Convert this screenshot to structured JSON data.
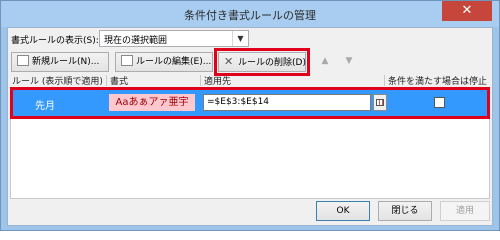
{
  "window": {
    "title": "条件付き書式ルールの管理",
    "close_symbol": "✕"
  },
  "show_rules": {
    "label": "書式ルールの表示(S):",
    "value": "現在の選択範囲"
  },
  "toolbar": {
    "new_rule": "新規ルール(N)...",
    "edit_rule": "ルールの編集(E)...",
    "delete_rule": "ルールの削除(D)",
    "move_up": "▲",
    "move_down": "▼"
  },
  "columns": {
    "rule": "ルール (表示順で適用)",
    "format": "書式",
    "applies_to": "適用先",
    "stop_if_true": "条件を満たす場合は停止"
  },
  "rules": [
    {
      "name": "先月",
      "preview": "Aaあぁアァ亜宇",
      "applies_to": "=$E$3:$E$14",
      "stop_if_true": false
    }
  ],
  "footer": {
    "ok": "OK",
    "close": "閉じる",
    "apply": "適用"
  },
  "colors": {
    "selection": "#3399ff",
    "highlight": "#e0001b",
    "preview_bg": "#ffc7ce",
    "preview_fg": "#9c0006"
  }
}
